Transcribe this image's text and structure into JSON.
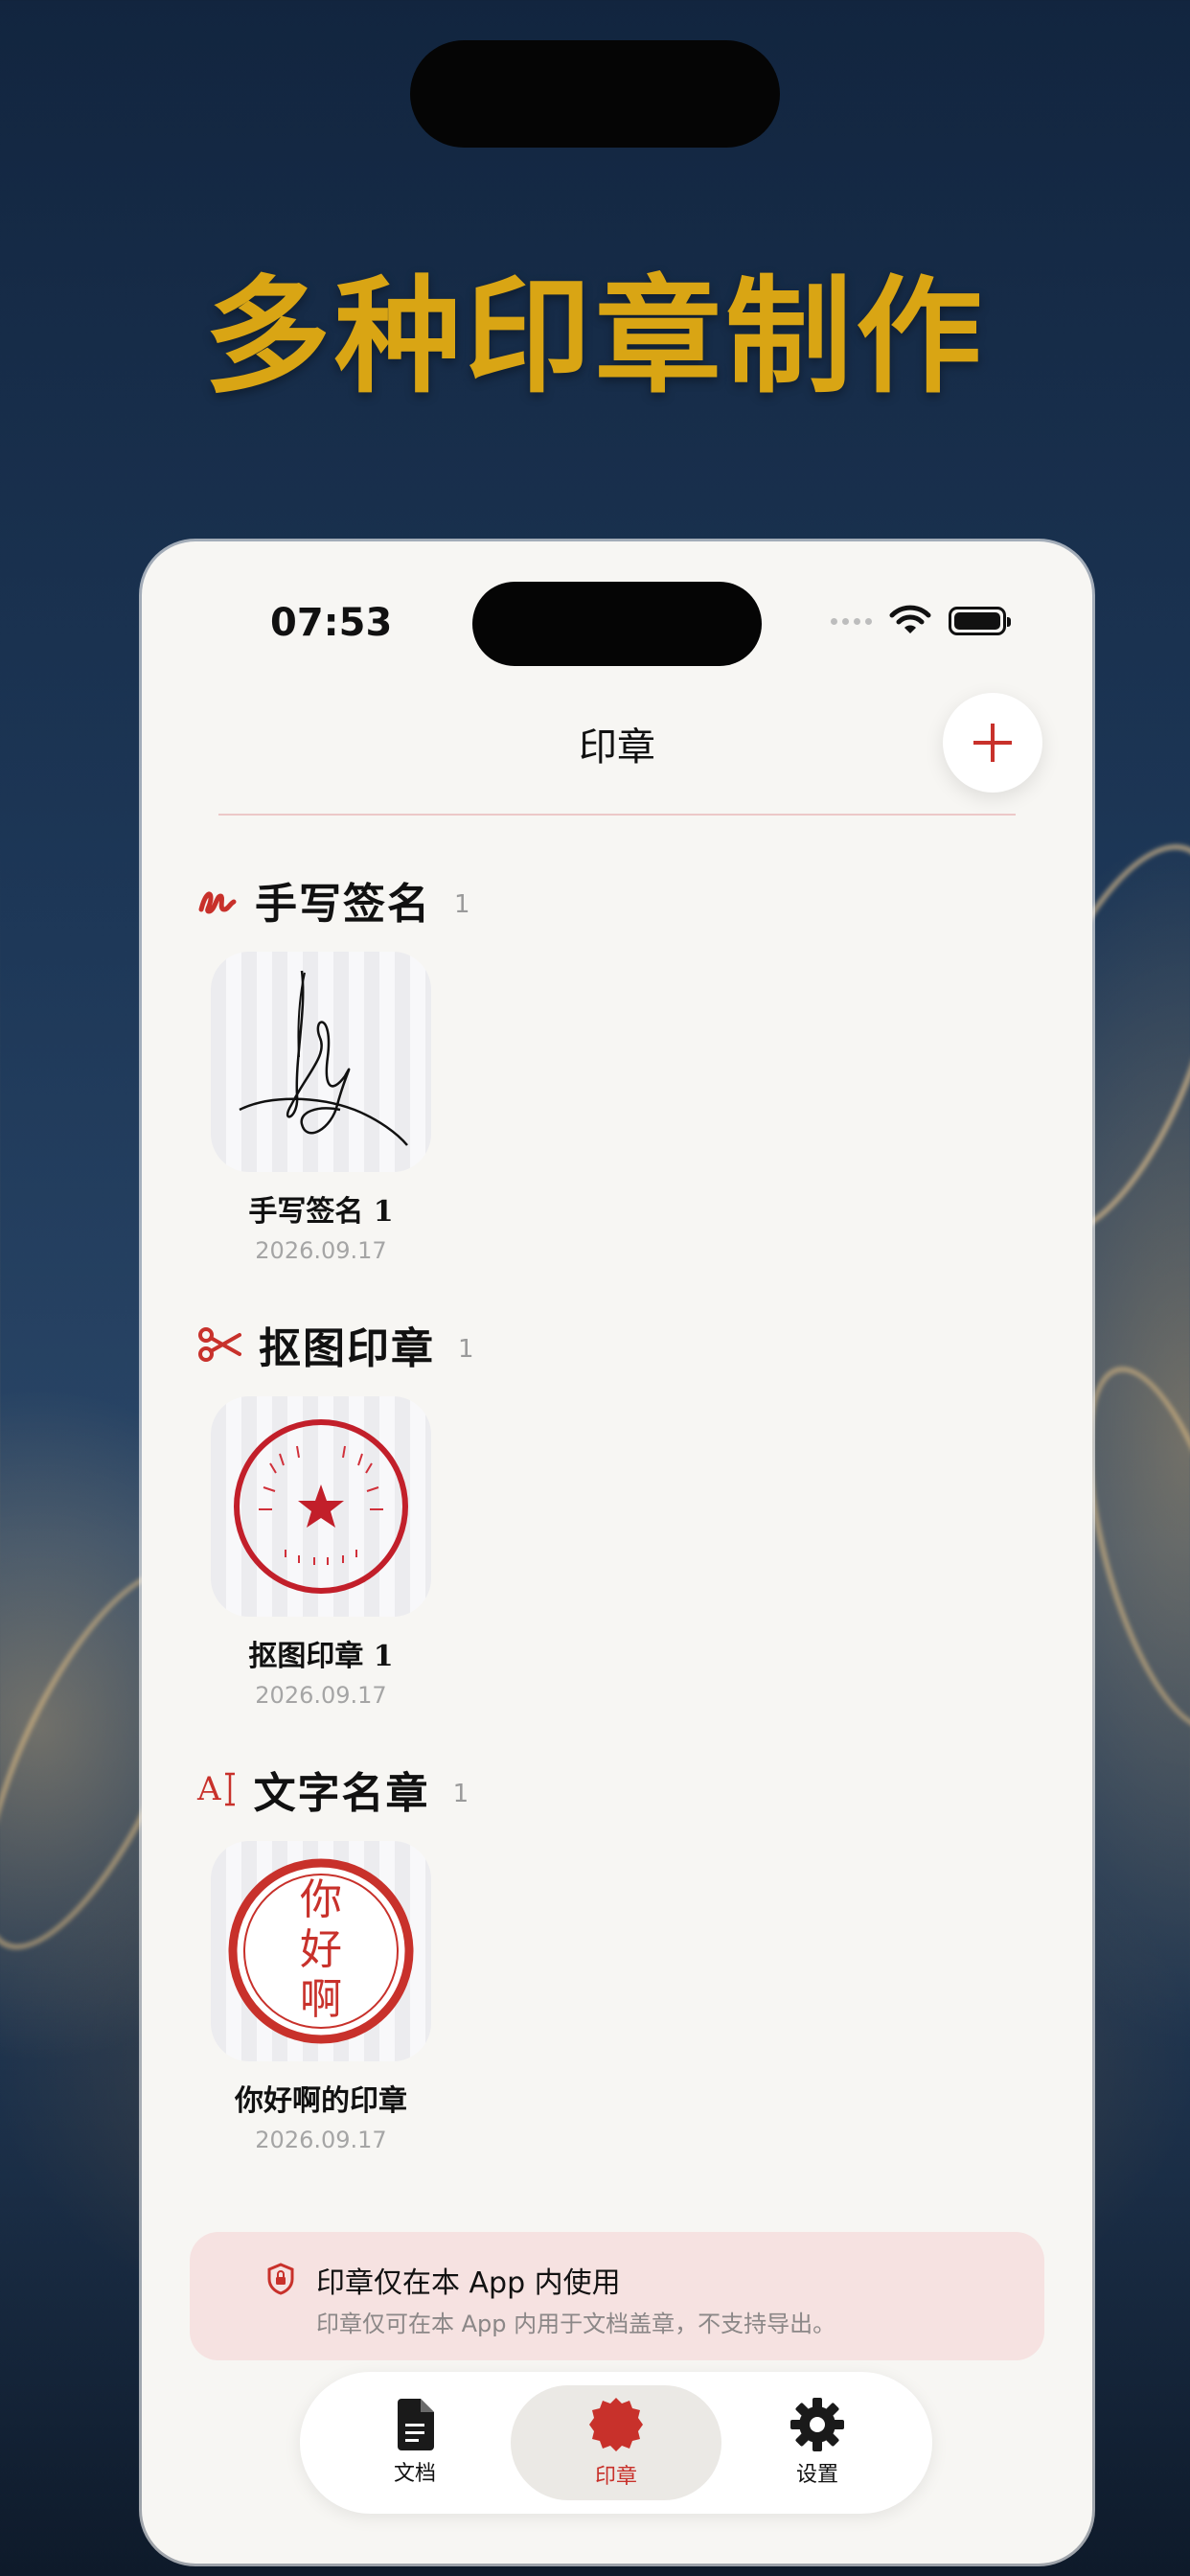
{
  "headline": "多种印章制作",
  "status_bar": {
    "time": "07:53"
  },
  "nav": {
    "title": "印章"
  },
  "sections": [
    {
      "icon": "signature-icon",
      "title": "手写签名",
      "count": "1",
      "items": [
        {
          "name": "手写签名 1",
          "date": "2026.09.17"
        }
      ]
    },
    {
      "icon": "scissors-icon",
      "title": "抠图印章",
      "count": "1",
      "items": [
        {
          "name": "抠图印章 1",
          "date": "2026.09.17"
        }
      ]
    },
    {
      "icon": "text-format-icon",
      "title": "文字名章",
      "count": "1",
      "items": [
        {
          "name": "你好啊的印章",
          "date": "2026.09.17",
          "seal_chars": [
            "你",
            "好",
            "啊"
          ]
        }
      ]
    }
  ],
  "notice": {
    "icon": "shield-lock-icon",
    "title": "印章仅在本 App 内使用",
    "description": "印章仅可在本 App 内用于文档盖章，不支持导出。"
  },
  "tabs": [
    {
      "label": "文档",
      "icon": "document-icon",
      "active": false
    },
    {
      "label": "印章",
      "icon": "seal-icon",
      "active": true
    },
    {
      "label": "设置",
      "icon": "gear-icon",
      "active": false
    }
  ],
  "colors": {
    "accent": "#c8312b",
    "headline": "#d9a514",
    "text_icon": "A"
  }
}
